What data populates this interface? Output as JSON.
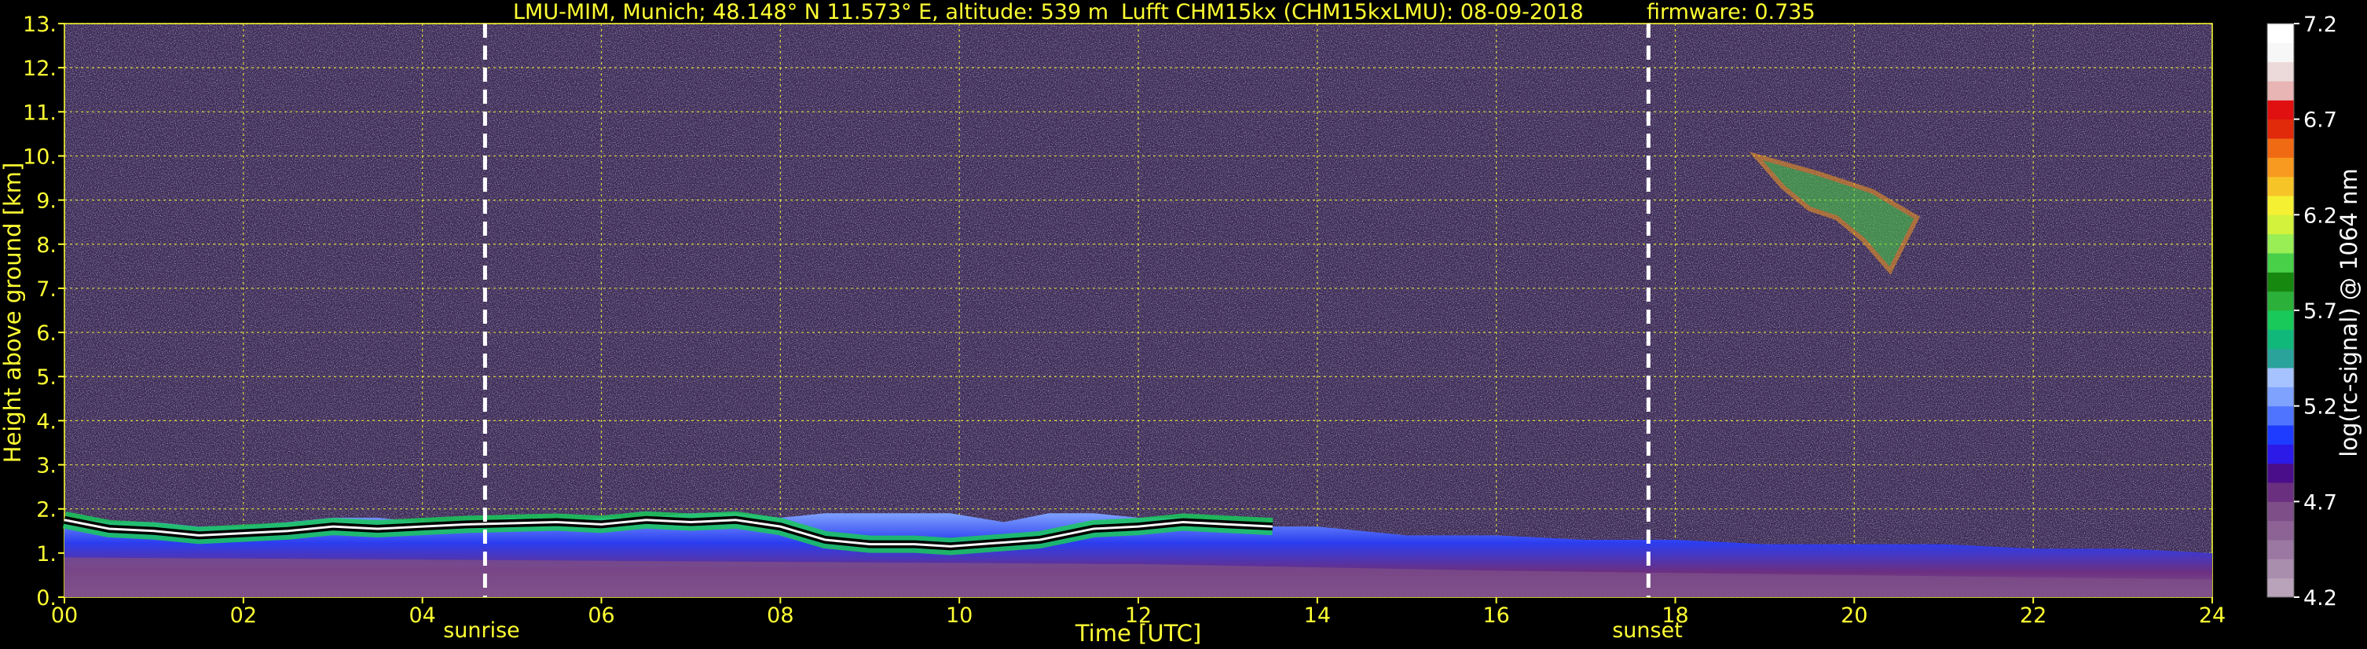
{
  "chart_data": {
    "type": "heatmap",
    "title": "LMU-MIM, Munich; 48.148° N 11.573° E, altitude: 539 m",
    "title2": "Lufft CHM15kx (CHM15kxLMU): 08-09-2018",
    "title3": "firmware: 0.735",
    "xlabel": "Time [UTC]",
    "ylabel": "Height above ground [km]",
    "xlim": [
      0,
      24
    ],
    "ylim": [
      0,
      13
    ],
    "x_ticks": [
      "00",
      "02",
      "04",
      "06",
      "08",
      "10",
      "12",
      "14",
      "16",
      "18",
      "20",
      "22",
      "24"
    ],
    "y_ticks": [
      "0.",
      "1.",
      "2.",
      "3.",
      "4.",
      "5.",
      "6.",
      "7.",
      "8.",
      "9.",
      "10.",
      "11.",
      "12.",
      "13."
    ],
    "grid": true,
    "colorbar": {
      "label": "log(rc-signal) @ 1064 nm",
      "range": [
        4.2,
        7.2
      ],
      "ticks": [
        "4.2",
        "4.7",
        "5.2",
        "5.7",
        "6.2",
        "6.7",
        "7.2"
      ],
      "colors": [
        "#b8a3bb",
        "#a98eae",
        "#9a78a1",
        "#8c6394",
        "#7d4e88",
        "#6b2f80",
        "#4a0e8a",
        "#2b1ae8",
        "#1e3cff",
        "#4f74ff",
        "#7fa2ff",
        "#a7c3ff",
        "#2aa39a",
        "#10b87a",
        "#19c95a",
        "#2bb13a",
        "#16870f",
        "#48d048",
        "#99ee55",
        "#d2f23c",
        "#f5f032",
        "#f7c428",
        "#f79a1f",
        "#f06a14",
        "#e02a0a",
        "#e01010",
        "#e8b4b4",
        "#ecdada",
        "#f7f7f7",
        "#ffffff"
      ]
    },
    "annotations": [
      {
        "text": "sunrise",
        "x": 4.7
      },
      {
        "text": "sunset",
        "x": 17.7
      }
    ],
    "boundary_layer_top": {
      "x": [
        0.0,
        0.5,
        1.0,
        1.5,
        2.0,
        2.5,
        3.0,
        3.5,
        4.0,
        4.5,
        5.0,
        5.5,
        6.0,
        6.5,
        7.0,
        7.5,
        8.0,
        8.5,
        9.0,
        9.5,
        9.9,
        10.5,
        11.0,
        11.5,
        12.0,
        12.5,
        13.0,
        13.5,
        14.0,
        14.5,
        15.0,
        16.0,
        17.0,
        18.0,
        19.0,
        20.0,
        21.0,
        22.0,
        23.0,
        24.0
      ],
      "y": [
        1.8,
        1.7,
        1.7,
        1.6,
        1.6,
        1.7,
        1.8,
        1.8,
        1.7,
        1.7,
        1.8,
        1.7,
        1.8,
        1.8,
        1.9,
        1.9,
        1.8,
        1.9,
        1.9,
        1.9,
        1.9,
        1.7,
        1.9,
        1.9,
        1.8,
        1.8,
        1.7,
        1.6,
        1.6,
        1.5,
        1.4,
        1.4,
        1.3,
        1.3,
        1.2,
        1.2,
        1.2,
        1.1,
        1.1,
        1.0
      ]
    },
    "cloud_layer": {
      "x": [
        0.0,
        0.5,
        1.0,
        1.5,
        2.0,
        2.5,
        3.0,
        3.5,
        4.0,
        4.5,
        5.5,
        6.0,
        6.5,
        7.0,
        7.5,
        8.0,
        8.5,
        9.0,
        9.5,
        9.9,
        10.9,
        11.5,
        12.0,
        12.5,
        13.0,
        13.5
      ],
      "y": [
        1.75,
        1.55,
        1.5,
        1.4,
        1.45,
        1.5,
        1.6,
        1.55,
        1.6,
        1.65,
        1.7,
        1.65,
        1.75,
        1.7,
        1.75,
        1.6,
        1.3,
        1.2,
        1.2,
        1.15,
        1.3,
        1.55,
        1.6,
        1.7,
        1.65,
        1.6
      ]
    },
    "cirrus": {
      "x": [
        18.9,
        19.2,
        19.5,
        19.8,
        20.1,
        20.4,
        20.7,
        20.2,
        19.6
      ],
      "y": [
        10.0,
        9.3,
        8.8,
        8.6,
        8.1,
        7.4,
        8.6,
        9.2,
        9.6
      ]
    }
  }
}
